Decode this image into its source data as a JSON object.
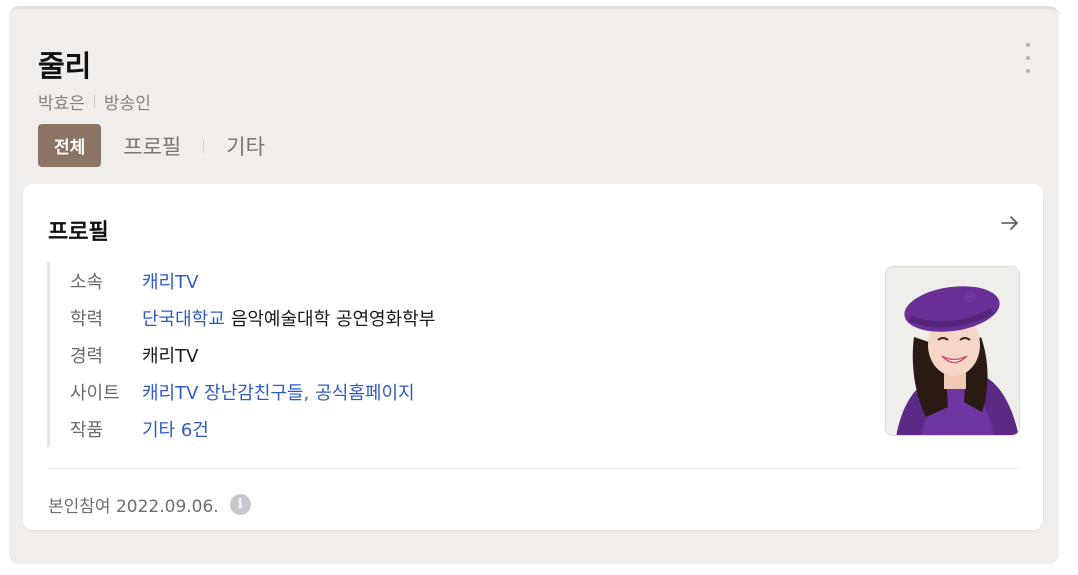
{
  "header": {
    "title": "줄리",
    "real_name": "박효은",
    "occupation": "방송인",
    "more_icon": "more-vertical-icon"
  },
  "tabs": [
    {
      "label": "전체",
      "active": true
    },
    {
      "label": "프로필",
      "active": false
    },
    {
      "label": "기타",
      "active": false
    }
  ],
  "profile": {
    "title": "프로필",
    "arrow_icon": "arrow-right-icon",
    "rows": {
      "agency": {
        "label": "소속",
        "value": "캐리TV"
      },
      "education": {
        "label": "학력",
        "school": "단국대학교",
        "detail": "음악예술대학 공연영화학부"
      },
      "career": {
        "label": "경력",
        "value": "캐리TV"
      },
      "site": {
        "label": "사이트",
        "links": [
          "캐리TV 장난감친구들,",
          "공식홈페이지"
        ]
      },
      "works": {
        "label": "작품",
        "value": "기타 6건"
      }
    },
    "footer": {
      "text": "본인참여 2022.09.06.",
      "info_icon": "info-icon"
    }
  },
  "colors": {
    "accent": "#8c7464",
    "link": "#2f5bc7",
    "panel_bg": "#f1edea"
  }
}
